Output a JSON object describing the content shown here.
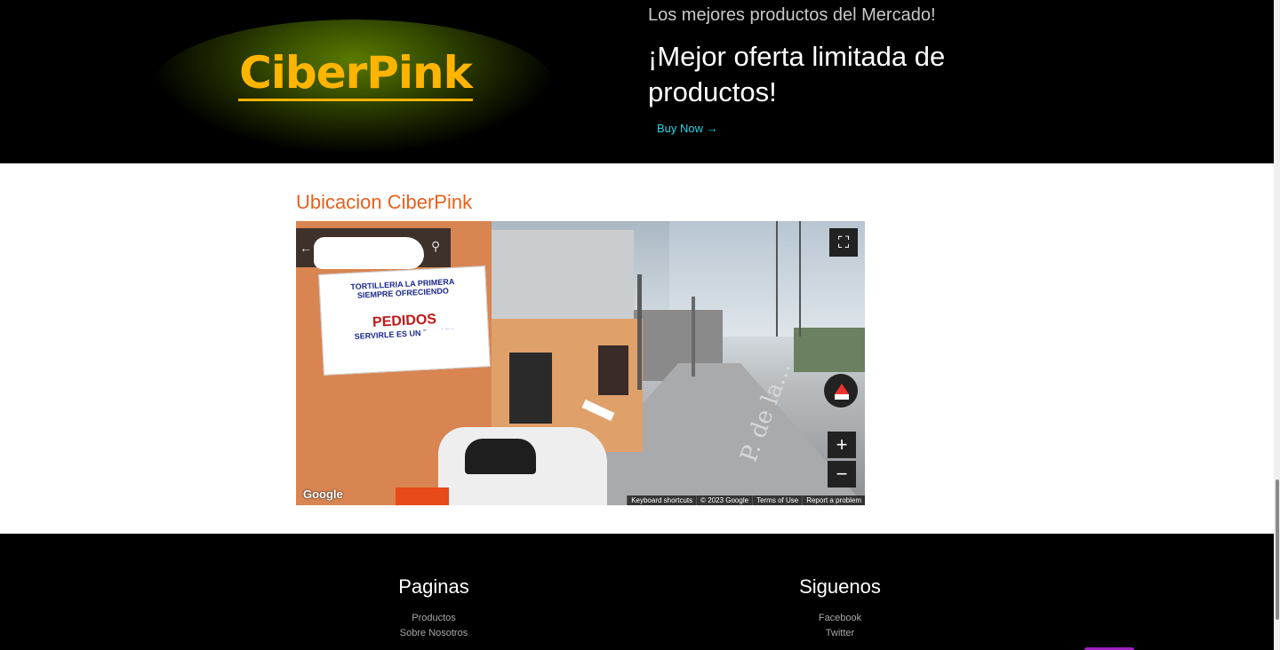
{
  "hero": {
    "logo_text": "CiberPink",
    "tagline": "Los mejores productos del Mercado!",
    "title": "¡Mejor oferta limitada de productos!",
    "buy_link": "Buy Now →"
  },
  "location": {
    "title": "Ubicacion CiberPink",
    "map": {
      "sign_lines": [
        "TORTILLERIA LA PRIMERA",
        "SIEMPRE OFRECIENDO",
        "PEDIDOS",
        "SERVIRLE ES UN PLACER"
      ],
      "street_label": "P. de la...",
      "zoom_in": "+",
      "zoom_out": "−",
      "fullscreen_icon": "⛶",
      "google_logo": "Google",
      "attribution": [
        "Keyboard shortcuts",
        "© 2023 Google",
        "Terms of Use",
        "Report a problem"
      ]
    }
  },
  "footer": {
    "pages": {
      "title": "Paginas",
      "links": [
        "Productos",
        "Sobre Nosotros"
      ]
    },
    "follow": {
      "title": "Siguenos",
      "links": [
        "Facebook",
        "Twitter"
      ]
    }
  },
  "colors": {
    "logo": "#ffb400",
    "accent_link": "#27d4e8",
    "section_title": "#e8601c"
  }
}
